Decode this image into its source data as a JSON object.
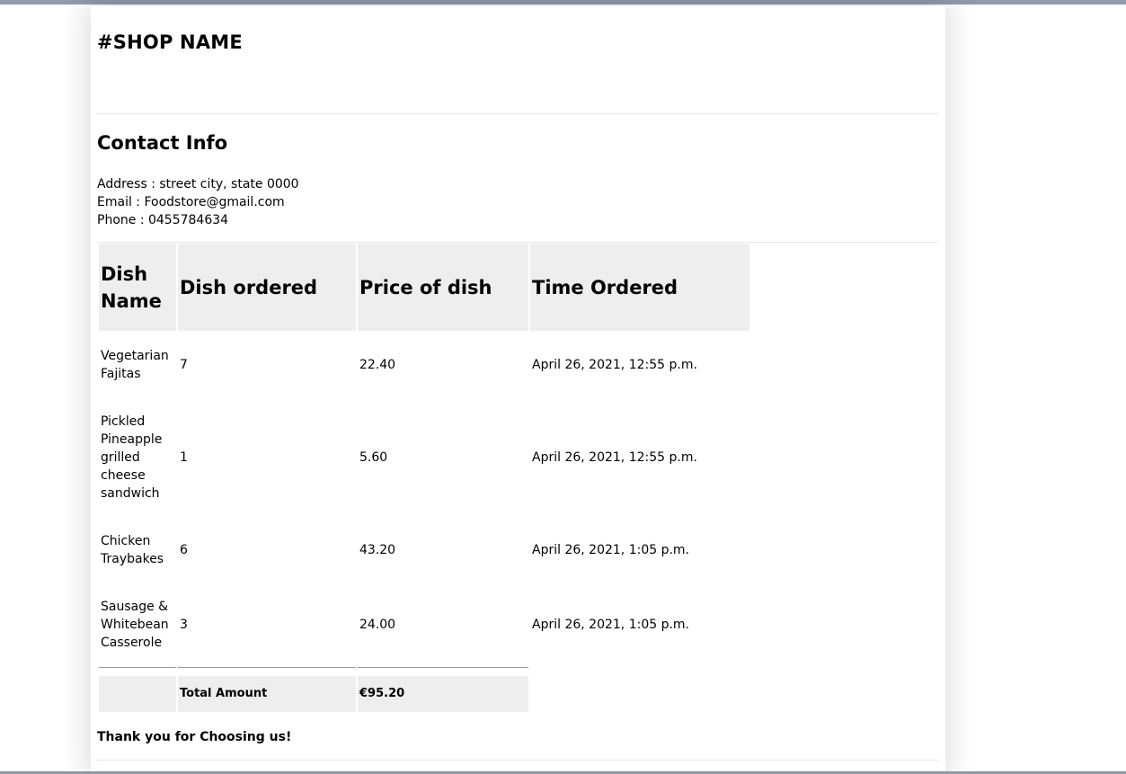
{
  "shop": {
    "name": "#SHOP NAME"
  },
  "contact": {
    "title": "Contact Info",
    "address": "Address : street city, state 0000",
    "email": "Email : Foodstore@gmail.com",
    "phone": "Phone : 0455784634"
  },
  "table": {
    "headers": {
      "dish_name": "Dish Name",
      "dish_ordered": "Dish ordered",
      "price": "Price of dish",
      "time": "Time Ordered"
    },
    "rows": [
      {
        "name": "Vegetarian Fajitas",
        "qty": "7",
        "price": "22.40",
        "time": "April 26, 2021, 12:55 p.m."
      },
      {
        "name": "Pickled Pineapple grilled cheese sandwich",
        "qty": "1",
        "price": "5.60",
        "time": "April 26, 2021, 12:55 p.m."
      },
      {
        "name": "Chicken Traybakes",
        "qty": "6",
        "price": "43.20",
        "time": "April 26, 2021, 1:05 p.m."
      },
      {
        "name": "Sausage & Whitebean Casserole",
        "qty": "3",
        "price": "24.00",
        "time": "April 26, 2021, 1:05 p.m."
      }
    ],
    "total_label": "Total Amount",
    "total_value": "€95.20"
  },
  "footer": {
    "thanks": "Thank you for Choosing us!"
  }
}
